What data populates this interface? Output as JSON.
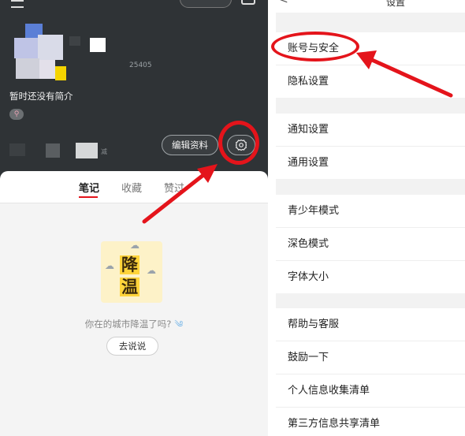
{
  "profile": {
    "user_id_partial": "25405",
    "bio": "暂时还没有简介",
    "location_glyph": "⚲",
    "edit_profile_label": "编辑资料",
    "fragment_text": "减"
  },
  "tabs": [
    {
      "label": "笔记",
      "active": true
    },
    {
      "label": "收藏",
      "active": false
    },
    {
      "label": "赞过",
      "active": false
    }
  ],
  "empty_state": {
    "sticker_char_top": "降",
    "sticker_char_bottom": "温",
    "message": "你在的城市降温了吗?",
    "wind_glyph": "༄",
    "button_label": "去说说"
  },
  "settings": {
    "back_glyph": "<",
    "title": "设置",
    "groups": [
      {
        "items": [
          "账号与安全",
          "隐私设置"
        ]
      },
      {
        "items": [
          "通知设置",
          "通用设置"
        ]
      },
      {
        "items": [
          "青少年模式",
          "深色模式",
          "字体大小"
        ]
      },
      {
        "items": [
          "帮助与客服",
          "鼓励一下",
          "个人信息收集清单",
          "第三方信息共享清单"
        ]
      }
    ]
  },
  "colors": {
    "highlight_red": "#e4141b",
    "profile_bg": "#2f3336",
    "accent_red": "#e4141b"
  },
  "icons": {
    "settings": "gear-icon",
    "menu": "menu-icon",
    "location": "location-icon",
    "back": "back-arrow-icon"
  }
}
